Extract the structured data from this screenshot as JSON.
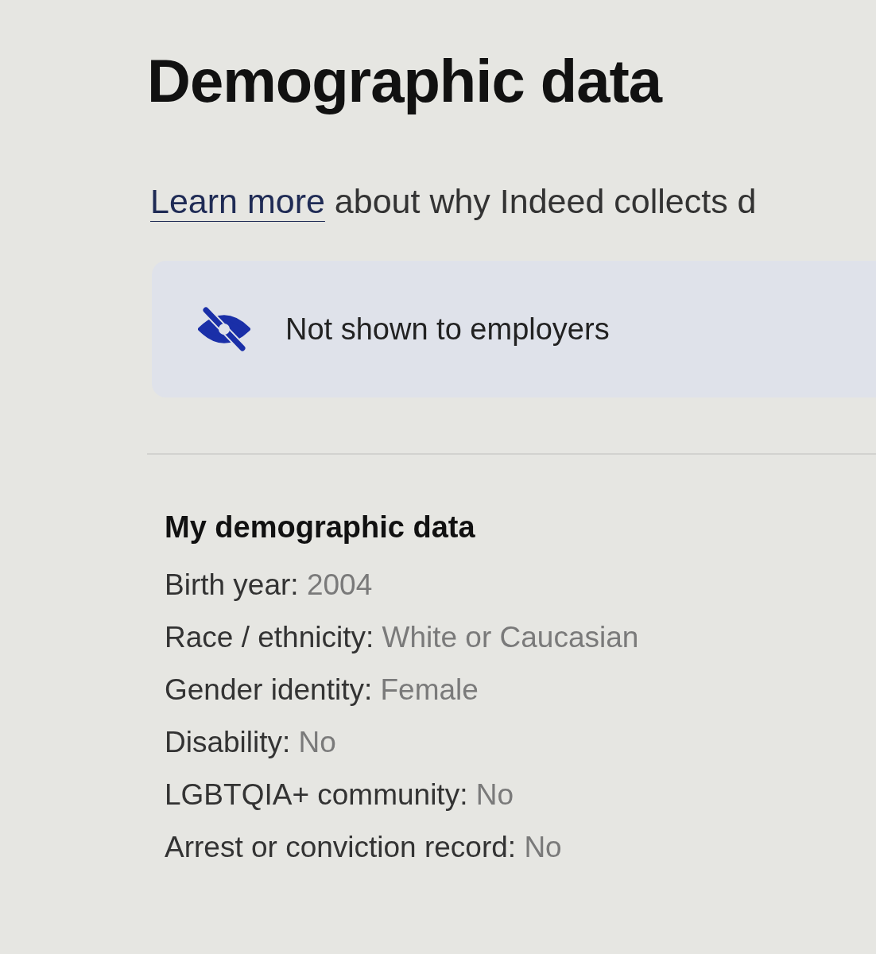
{
  "page_title": "Demographic data",
  "intro": {
    "link": "Learn more",
    "text": "about why Indeed collects d"
  },
  "notice": {
    "text": "Not shown to employers"
  },
  "section": {
    "title": "My demographic data",
    "items": [
      {
        "label": "Birth year:",
        "value": "2004"
      },
      {
        "label": "Race / ethnicity:",
        "value": "White or Caucasian"
      },
      {
        "label": "Gender identity:",
        "value": "Female"
      },
      {
        "label": "Disability:",
        "value": "No"
      },
      {
        "label": "LGBTQIA+ community:",
        "value": "No"
      },
      {
        "label": "Arrest or conviction record:",
        "value": "No"
      }
    ]
  }
}
